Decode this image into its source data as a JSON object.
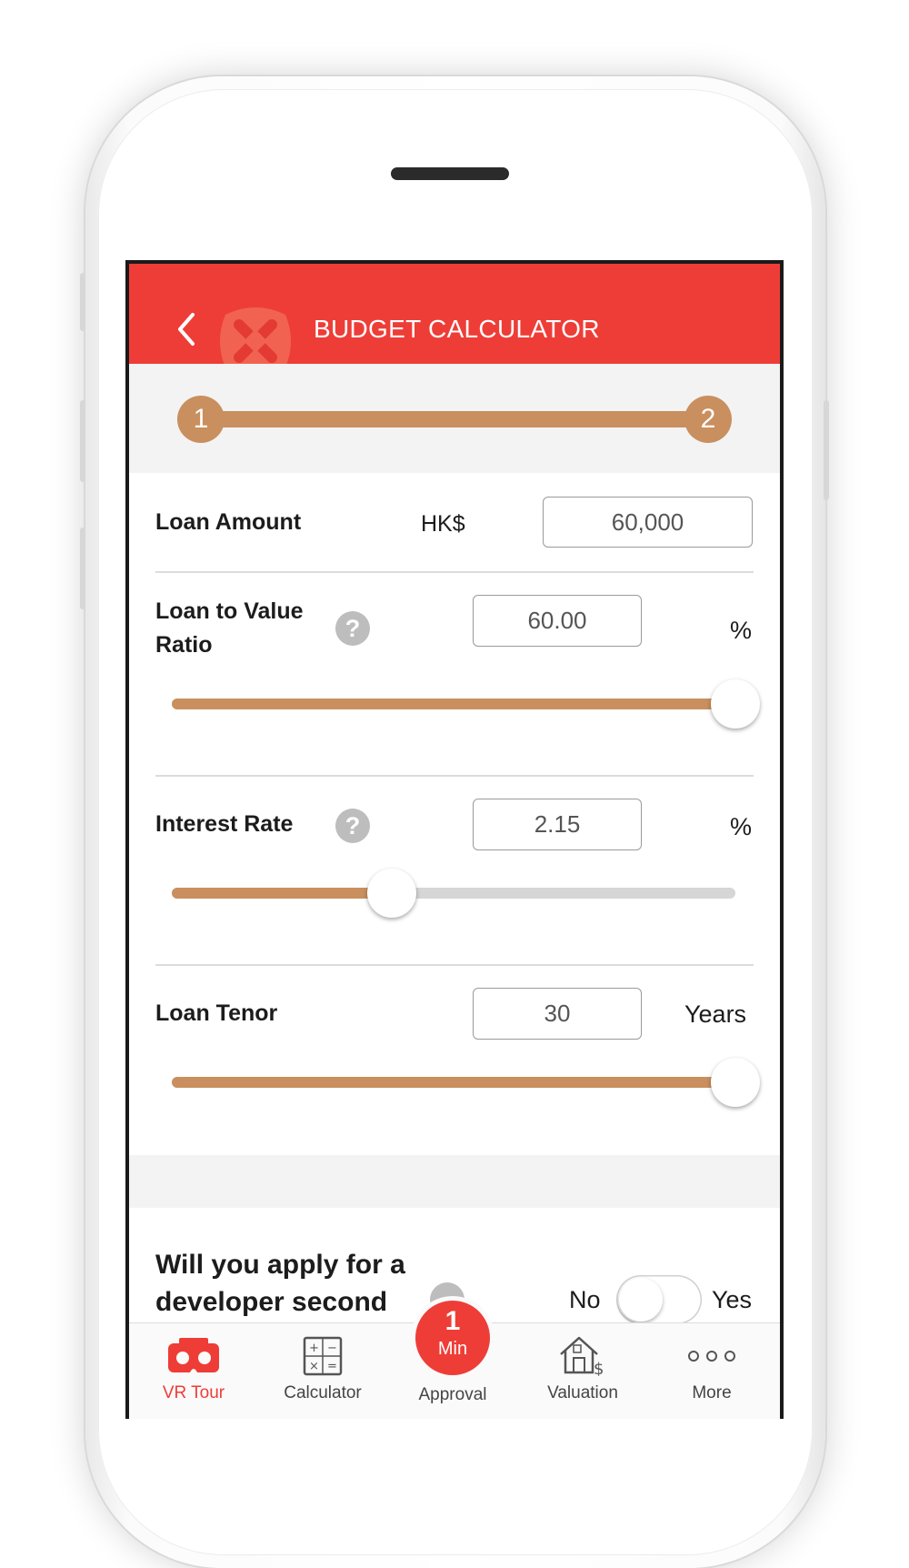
{
  "header": {
    "title": "BUDGET CALCULATOR"
  },
  "stepper": {
    "steps": [
      "1",
      "2"
    ],
    "current_step": 2
  },
  "form": {
    "loan_amount": {
      "label": "Loan Amount",
      "currency": "HK$",
      "value": "60,000"
    },
    "ltv": {
      "label_line1": "Loan to Value",
      "label_line2": "Ratio",
      "help": "?",
      "value": "60.00",
      "unit": "%",
      "slider_fraction": 1.0
    },
    "interest_rate": {
      "label": "Interest Rate",
      "help": "?",
      "value": "2.15",
      "unit": "%",
      "slider_fraction": 0.38
    },
    "loan_tenor": {
      "label": "Loan Tenor",
      "value": "30",
      "unit": "Years",
      "slider_fraction": 1.0
    }
  },
  "developer_question": {
    "line1": "Will you apply for a",
    "line2": "developer second",
    "no_label": "No",
    "yes_label": "Yes",
    "selected": "No"
  },
  "bottom_nav": {
    "items": [
      {
        "label": "VR Tour",
        "icon": "vr-headset-icon",
        "active": true
      },
      {
        "label": "Calculator",
        "icon": "calculator-icon",
        "active": false
      },
      {
        "label": "Approval",
        "icon": "approval-badge",
        "active": false
      },
      {
        "label": "Valuation",
        "icon": "house-dollar-icon",
        "active": false
      },
      {
        "label": "More",
        "icon": "more-dots-icon",
        "active": false
      }
    ],
    "approval_badge": {
      "number": "1",
      "unit": "Min"
    }
  },
  "colors": {
    "brand_red": "#ee3d37",
    "slider_tan": "#c98f5e",
    "active_nav": "#ee3d37"
  }
}
